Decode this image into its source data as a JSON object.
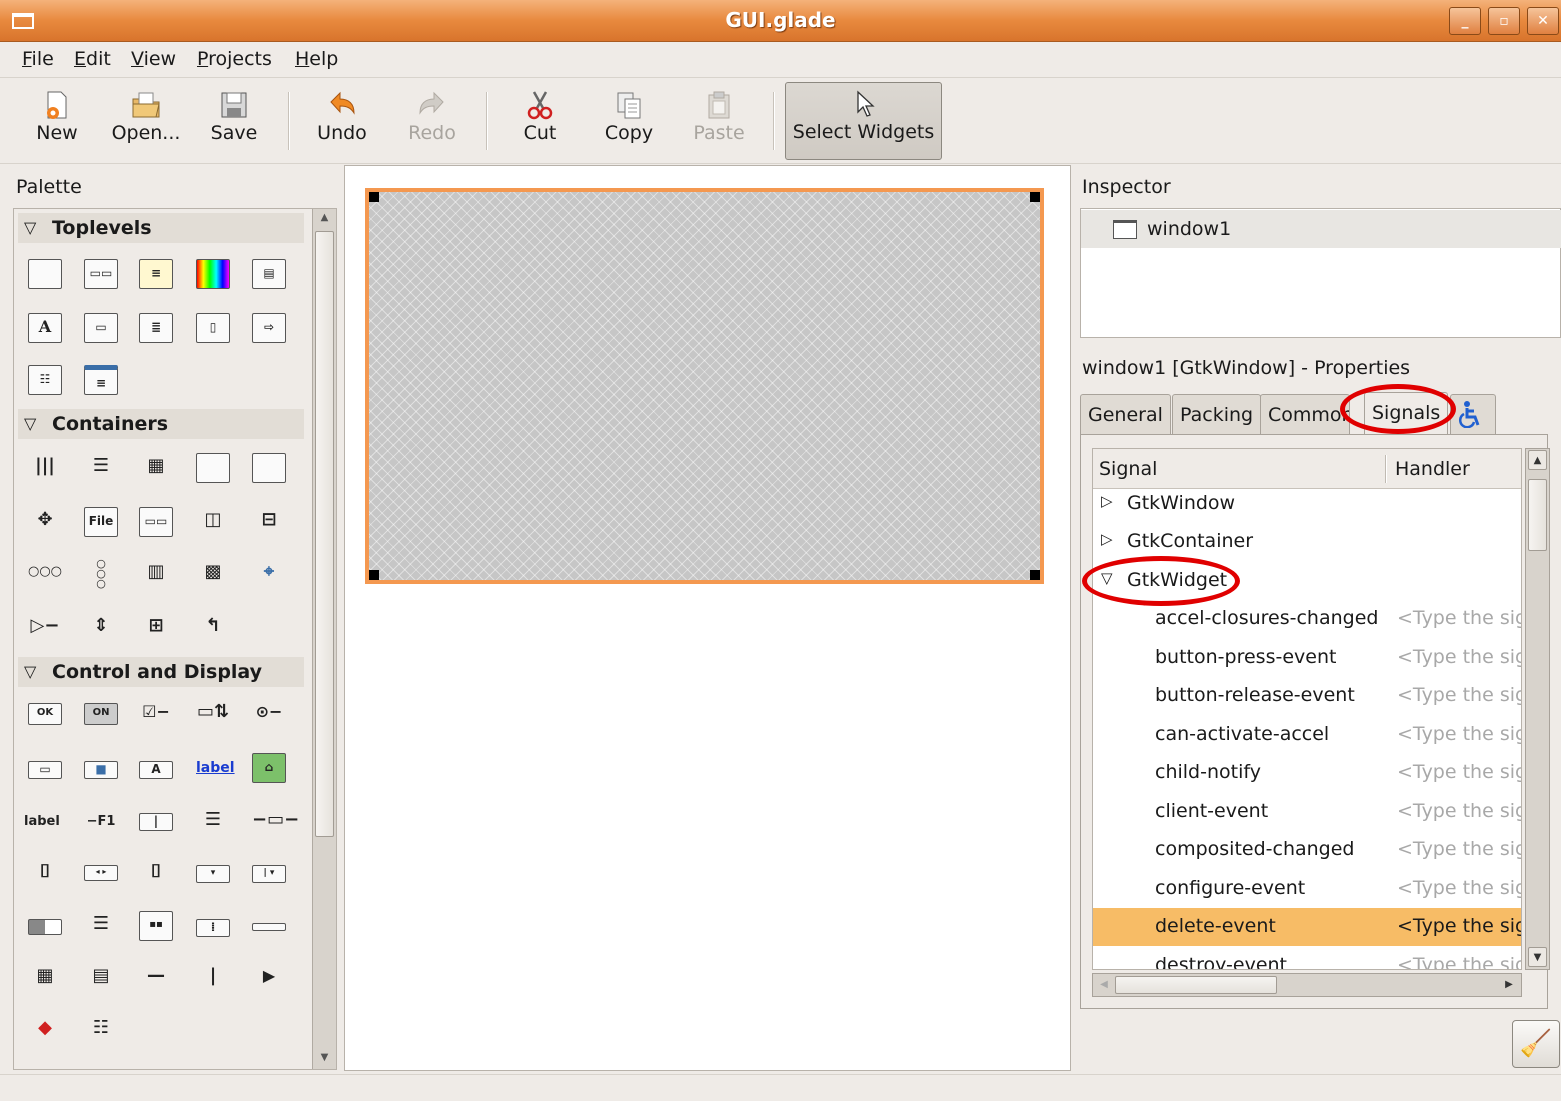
{
  "window": {
    "title": "GUI.glade"
  },
  "menu": [
    "File",
    "Edit",
    "View",
    "Projects",
    "Help"
  ],
  "toolbar": {
    "new": "New",
    "open": "Open...",
    "save": "Save",
    "undo": "Undo",
    "redo": "Redo",
    "cut": "Cut",
    "copy": "Copy",
    "paste": "Paste",
    "select": "Select Widgets"
  },
  "palette": {
    "title": "Palette",
    "groups": [
      "Toplevels",
      "Containers",
      "Control and Display"
    ],
    "icon_texts": {
      "file": "File",
      "ok": "OK",
      "on": "ON",
      "label_link": "label",
      "label_bold": "label",
      "accel": "F1",
      "a": "A"
    }
  },
  "inspector": {
    "title": "Inspector",
    "item": "window1"
  },
  "properties": {
    "title": "window1 [GtkWindow] - Properties",
    "tabs": [
      "General",
      "Packing",
      "Common",
      "Signals"
    ],
    "active_tab": "Signals"
  },
  "signals": {
    "col_signal": "Signal",
    "col_handler": "Handler",
    "groups": [
      {
        "name": "GtkWindow",
        "expanded": false
      },
      {
        "name": "GtkContainer",
        "expanded": false
      },
      {
        "name": "GtkWidget",
        "expanded": true
      }
    ],
    "rows": [
      {
        "name": "accel-closures-changed",
        "handler": "<Type the signal's handler here>"
      },
      {
        "name": "button-press-event",
        "handler": "<Type the signal's handler here>"
      },
      {
        "name": "button-release-event",
        "handler": "<Type the signal's handler here>"
      },
      {
        "name": "can-activate-accel",
        "handler": "<Type the signal's handler here>"
      },
      {
        "name": "child-notify",
        "handler": "<Type the signal's handler here>"
      },
      {
        "name": "client-event",
        "handler": "<Type the signal's handler here>"
      },
      {
        "name": "composited-changed",
        "handler": "<Type the signal's handler here>"
      },
      {
        "name": "configure-event",
        "handler": "<Type the signal's handler here>"
      },
      {
        "name": "delete-event",
        "handler": "<Type the signal's handler here>",
        "selected": true
      },
      {
        "name": "destroy-event",
        "handler": "<Type the signal's handler here>"
      }
    ]
  },
  "colors": {
    "accent": "#e8893e",
    "selection": "#f7bc66",
    "annotation": "#e00000"
  }
}
